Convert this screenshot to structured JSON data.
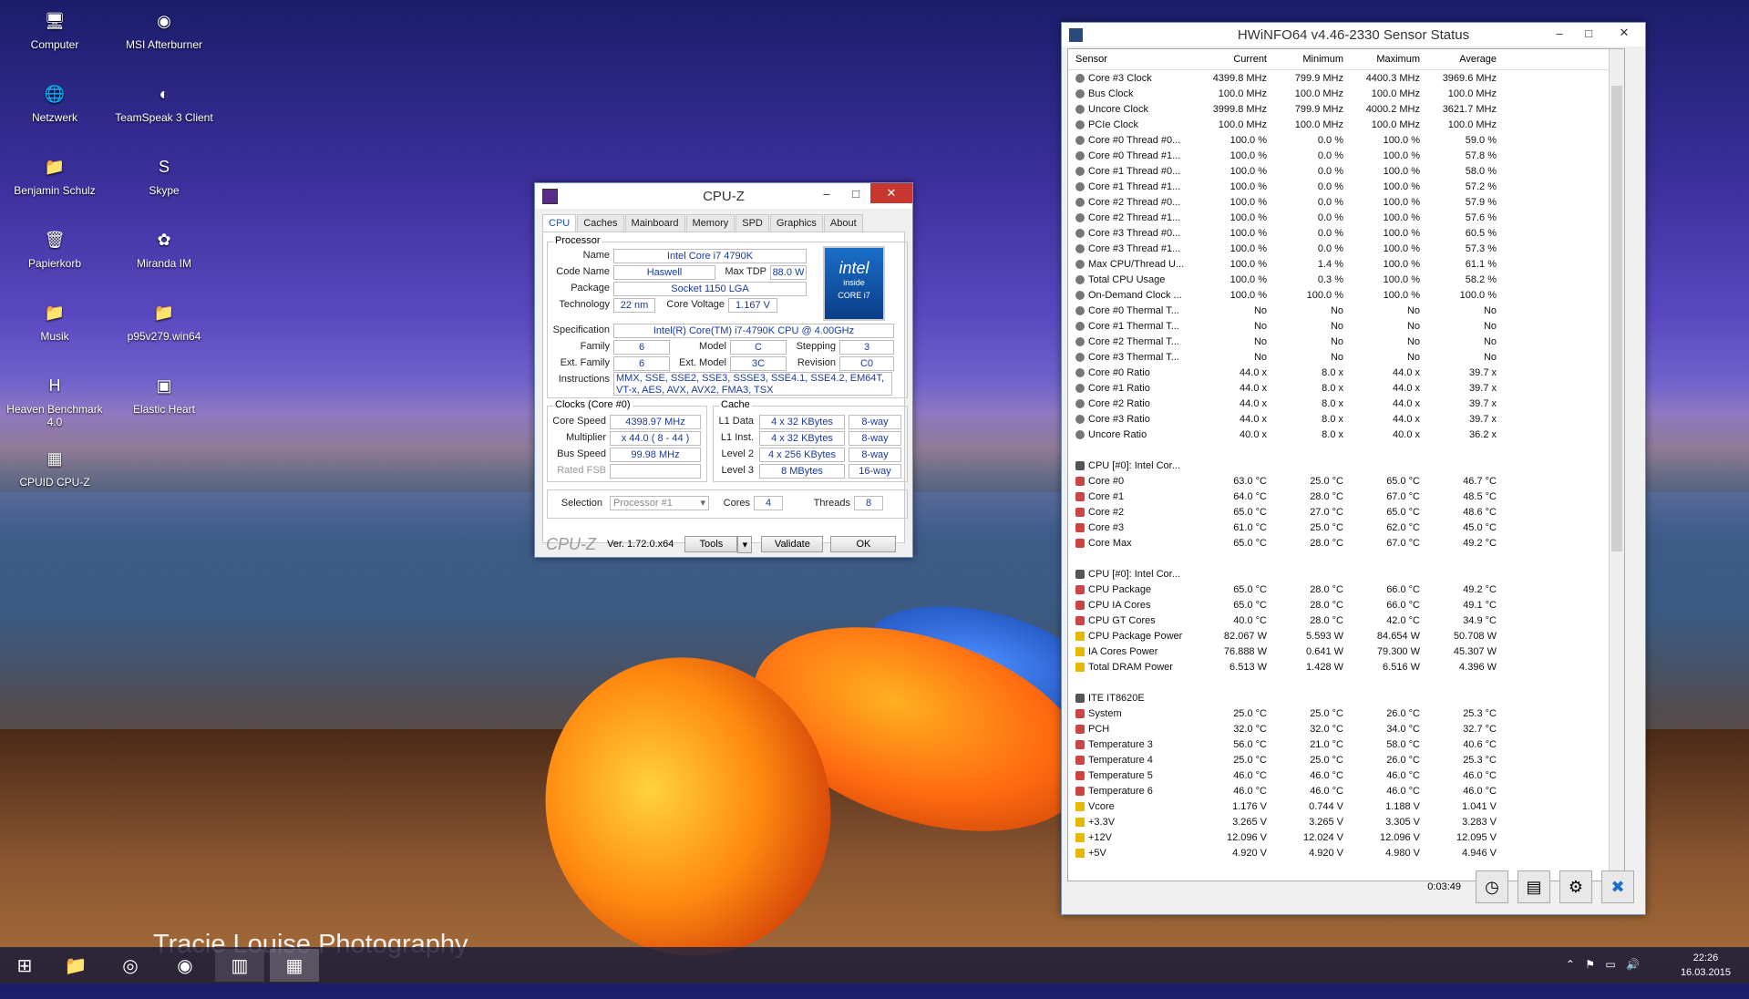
{
  "desktop": {
    "icons": [
      {
        "label": "Computer",
        "glyph": "🖥"
      },
      {
        "label": "MSI Afterburner",
        "glyph": "◉"
      },
      {
        "label": "Netzwerk",
        "glyph": "🌐"
      },
      {
        "label": "TeamSpeak 3 Client",
        "glyph": "◐"
      },
      {
        "label": "Benjamin Schulz",
        "glyph": "📁"
      },
      {
        "label": "Skype",
        "glyph": "S"
      },
      {
        "label": "Papierkorb",
        "glyph": "🗑"
      },
      {
        "label": "Miranda IM",
        "glyph": "✿"
      },
      {
        "label": "Musik",
        "glyph": "📁"
      },
      {
        "label": "p95v279.win64",
        "glyph": "📁"
      },
      {
        "label": "Heaven Benchmark 4.0",
        "glyph": "H"
      },
      {
        "label": "Elastic Heart",
        "glyph": "▣"
      },
      {
        "label": "CPUID CPU-Z",
        "glyph": "▦"
      }
    ],
    "photo_credit": "Tracie Louise Photography"
  },
  "cpuz": {
    "title": "CPU-Z",
    "tabs": [
      "CPU",
      "Caches",
      "Mainboard",
      "Memory",
      "SPD",
      "Graphics",
      "About"
    ],
    "processor_group": "Processor",
    "name_label": "Name",
    "name": "Intel Core i7 4790K",
    "codename_label": "Code Name",
    "codename": "Haswell",
    "maxtdp_label": "Max TDP",
    "maxtdp": "88.0 W",
    "package_label": "Package",
    "package": "Socket 1150 LGA",
    "technology_label": "Technology",
    "technology": "22 nm",
    "corevoltage_label": "Core Voltage",
    "corevoltage": "1.167 V",
    "spec_label": "Specification",
    "spec": "Intel(R) Core(TM) i7-4790K CPU @ 4.00GHz",
    "family_label": "Family",
    "family": "6",
    "model_label": "Model",
    "model": "C",
    "stepping_label": "Stepping",
    "stepping": "3",
    "extfamily_label": "Ext. Family",
    "extfamily": "6",
    "extmodel_label": "Ext. Model",
    "extmodel": "3C",
    "revision_label": "Revision",
    "revision": "C0",
    "instructions_label": "Instructions",
    "instructions": "MMX, SSE, SSE2, SSE3, SSSE3, SSE4.1, SSE4.2, EM64T, VT-x, AES, AVX, AVX2, FMA3, TSX",
    "intel_logo_top": "intel",
    "intel_logo_mid": "inside",
    "intel_logo_bot": "CORE i7",
    "clocks_group": "Clocks (Core #0)",
    "corespeed_label": "Core Speed",
    "corespeed": "4398.97 MHz",
    "multiplier_label": "Multiplier",
    "multiplier": "x 44.0 ( 8 - 44 )",
    "busspeed_label": "Bus Speed",
    "busspeed": "99.98 MHz",
    "ratedfsb_label": "Rated FSB",
    "ratedfsb": "",
    "cache_group": "Cache",
    "l1data_label": "L1 Data",
    "l1data": "4 x 32 KBytes",
    "l1data_way": "8-way",
    "l1inst_label": "L1 Inst.",
    "l1inst": "4 x 32 KBytes",
    "l1inst_way": "8-way",
    "level2_label": "Level 2",
    "level2": "4 x 256 KBytes",
    "level2_way": "8-way",
    "level3_label": "Level 3",
    "level3": "8 MBytes",
    "level3_way": "16-way",
    "selection_label": "Selection",
    "selection": "Processor #1",
    "cores_label": "Cores",
    "cores": "4",
    "threads_label": "Threads",
    "threads": "8",
    "brand": "CPU-Z",
    "version": "Ver. 1.72.0.x64",
    "tools_label": "Tools",
    "validate_label": "Validate",
    "ok_label": "OK"
  },
  "hwinfo": {
    "title": "HWiNFO64 v4.46-2330 Sensor Status",
    "columns": [
      "Sensor",
      "Current",
      "Minimum",
      "Maximum",
      "Average"
    ],
    "rows": [
      {
        "icon": "g",
        "name": "Core #3 Clock",
        "cur": "4399.8 MHz",
        "min": "799.9 MHz",
        "max": "4400.3 MHz",
        "avg": "3969.6 MHz"
      },
      {
        "icon": "g",
        "name": "Bus Clock",
        "cur": "100.0 MHz",
        "min": "100.0 MHz",
        "max": "100.0 MHz",
        "avg": "100.0 MHz"
      },
      {
        "icon": "g",
        "name": "Uncore Clock",
        "cur": "3999.8 MHz",
        "min": "799.9 MHz",
        "max": "4000.2 MHz",
        "avg": "3621.7 MHz"
      },
      {
        "icon": "g",
        "name": "PCIe Clock",
        "cur": "100.0 MHz",
        "min": "100.0 MHz",
        "max": "100.0 MHz",
        "avg": "100.0 MHz"
      },
      {
        "icon": "g",
        "name": "Core #0 Thread #0...",
        "cur": "100.0 %",
        "min": "0.0 %",
        "max": "100.0 %",
        "avg": "59.0 %"
      },
      {
        "icon": "g",
        "name": "Core #0 Thread #1...",
        "cur": "100.0 %",
        "min": "0.0 %",
        "max": "100.0 %",
        "avg": "57.8 %"
      },
      {
        "icon": "g",
        "name": "Core #1 Thread #0...",
        "cur": "100.0 %",
        "min": "0.0 %",
        "max": "100.0 %",
        "avg": "58.0 %"
      },
      {
        "icon": "g",
        "name": "Core #1 Thread #1...",
        "cur": "100.0 %",
        "min": "0.0 %",
        "max": "100.0 %",
        "avg": "57.2 %"
      },
      {
        "icon": "g",
        "name": "Core #2 Thread #0...",
        "cur": "100.0 %",
        "min": "0.0 %",
        "max": "100.0 %",
        "avg": "57.9 %"
      },
      {
        "icon": "g",
        "name": "Core #2 Thread #1...",
        "cur": "100.0 %",
        "min": "0.0 %",
        "max": "100.0 %",
        "avg": "57.6 %"
      },
      {
        "icon": "g",
        "name": "Core #3 Thread #0...",
        "cur": "100.0 %",
        "min": "0.0 %",
        "max": "100.0 %",
        "avg": "60.5 %"
      },
      {
        "icon": "g",
        "name": "Core #3 Thread #1...",
        "cur": "100.0 %",
        "min": "0.0 %",
        "max": "100.0 %",
        "avg": "57.3 %"
      },
      {
        "icon": "g",
        "name": "Max CPU/Thread U...",
        "cur": "100.0 %",
        "min": "1.4 %",
        "max": "100.0 %",
        "avg": "61.1 %"
      },
      {
        "icon": "g",
        "name": "Total CPU Usage",
        "cur": "100.0 %",
        "min": "0.3 %",
        "max": "100.0 %",
        "avg": "58.2 %"
      },
      {
        "icon": "g",
        "name": "On-Demand Clock ...",
        "cur": "100.0 %",
        "min": "100.0 %",
        "max": "100.0 %",
        "avg": "100.0 %"
      },
      {
        "icon": "g",
        "name": "Core #0 Thermal T...",
        "cur": "No",
        "min": "No",
        "max": "No",
        "avg": "No"
      },
      {
        "icon": "g",
        "name": "Core #1 Thermal T...",
        "cur": "No",
        "min": "No",
        "max": "No",
        "avg": "No"
      },
      {
        "icon": "g",
        "name": "Core #2 Thermal T...",
        "cur": "No",
        "min": "No",
        "max": "No",
        "avg": "No"
      },
      {
        "icon": "g",
        "name": "Core #3 Thermal T...",
        "cur": "No",
        "min": "No",
        "max": "No",
        "avg": "No"
      },
      {
        "icon": "g",
        "name": "Core #0 Ratio",
        "cur": "44.0 x",
        "min": "8.0 x",
        "max": "44.0 x",
        "avg": "39.7 x"
      },
      {
        "icon": "g",
        "name": "Core #1 Ratio",
        "cur": "44.0 x",
        "min": "8.0 x",
        "max": "44.0 x",
        "avg": "39.7 x"
      },
      {
        "icon": "g",
        "name": "Core #2 Ratio",
        "cur": "44.0 x",
        "min": "8.0 x",
        "max": "44.0 x",
        "avg": "39.7 x"
      },
      {
        "icon": "g",
        "name": "Core #3 Ratio",
        "cur": "44.0 x",
        "min": "8.0 x",
        "max": "44.0 x",
        "avg": "39.7 x"
      },
      {
        "icon": "g",
        "name": "Uncore Ratio",
        "cur": "40.0 x",
        "min": "8.0 x",
        "max": "40.0 x",
        "avg": "36.2 x"
      },
      {
        "icon": "",
        "name": "",
        "cur": "",
        "min": "",
        "max": "",
        "avg": ""
      },
      {
        "icon": "h",
        "name": "CPU [#0]: Intel Cor...",
        "cur": "",
        "min": "",
        "max": "",
        "avg": ""
      },
      {
        "icon": "t",
        "name": "Core #0",
        "cur": "63.0 °C",
        "min": "25.0 °C",
        "max": "65.0 °C",
        "avg": "46.7 °C"
      },
      {
        "icon": "t",
        "name": "Core #1",
        "cur": "64.0 °C",
        "min": "28.0 °C",
        "max": "67.0 °C",
        "avg": "48.5 °C"
      },
      {
        "icon": "t",
        "name": "Core #2",
        "cur": "65.0 °C",
        "min": "27.0 °C",
        "max": "65.0 °C",
        "avg": "48.6 °C"
      },
      {
        "icon": "t",
        "name": "Core #3",
        "cur": "61.0 °C",
        "min": "25.0 °C",
        "max": "62.0 °C",
        "avg": "45.0 °C"
      },
      {
        "icon": "t",
        "name": "Core Max",
        "cur": "65.0 °C",
        "min": "28.0 °C",
        "max": "67.0 °C",
        "avg": "49.2 °C"
      },
      {
        "icon": "",
        "name": "",
        "cur": "",
        "min": "",
        "max": "",
        "avg": ""
      },
      {
        "icon": "h",
        "name": "CPU [#0]: Intel Cor...",
        "cur": "",
        "min": "",
        "max": "",
        "avg": ""
      },
      {
        "icon": "t",
        "name": "CPU Package",
        "cur": "65.0 °C",
        "min": "28.0 °C",
        "max": "66.0 °C",
        "avg": "49.2 °C"
      },
      {
        "icon": "t",
        "name": "CPU IA Cores",
        "cur": "65.0 °C",
        "min": "28.0 °C",
        "max": "66.0 °C",
        "avg": "49.1 °C"
      },
      {
        "icon": "t",
        "name": "CPU GT Cores",
        "cur": "40.0 °C",
        "min": "28.0 °C",
        "max": "42.0 °C",
        "avg": "34.9 °C"
      },
      {
        "icon": "p",
        "name": "CPU Package Power",
        "cur": "82.067 W",
        "min": "5.593 W",
        "max": "84.654 W",
        "avg": "50.708 W"
      },
      {
        "icon": "p",
        "name": "IA Cores Power",
        "cur": "76.888 W",
        "min": "0.641 W",
        "max": "79.300 W",
        "avg": "45.307 W"
      },
      {
        "icon": "p",
        "name": "Total DRAM Power",
        "cur": "6.513 W",
        "min": "1.428 W",
        "max": "6.516 W",
        "avg": "4.396 W"
      },
      {
        "icon": "",
        "name": "",
        "cur": "",
        "min": "",
        "max": "",
        "avg": ""
      },
      {
        "icon": "h",
        "name": "ITE IT8620E",
        "cur": "",
        "min": "",
        "max": "",
        "avg": ""
      },
      {
        "icon": "t",
        "name": "System",
        "cur": "25.0 °C",
        "min": "25.0 °C",
        "max": "26.0 °C",
        "avg": "25.3 °C"
      },
      {
        "icon": "t",
        "name": "PCH",
        "cur": "32.0 °C",
        "min": "32.0 °C",
        "max": "34.0 °C",
        "avg": "32.7 °C"
      },
      {
        "icon": "t",
        "name": "Temperature 3",
        "cur": "56.0 °C",
        "min": "21.0 °C",
        "max": "58.0 °C",
        "avg": "40.6 °C"
      },
      {
        "icon": "t",
        "name": "Temperature 4",
        "cur": "25.0 °C",
        "min": "25.0 °C",
        "max": "26.0 °C",
        "avg": "25.3 °C"
      },
      {
        "icon": "t",
        "name": "Temperature 5",
        "cur": "46.0 °C",
        "min": "46.0 °C",
        "max": "46.0 °C",
        "avg": "46.0 °C"
      },
      {
        "icon": "t",
        "name": "Temperature 6",
        "cur": "46.0 °C",
        "min": "46.0 °C",
        "max": "46.0 °C",
        "avg": "46.0 °C"
      },
      {
        "icon": "p",
        "name": "Vcore",
        "cur": "1.176 V",
        "min": "0.744 V",
        "max": "1.188 V",
        "avg": "1.041 V"
      },
      {
        "icon": "p",
        "name": "+3.3V",
        "cur": "3.265 V",
        "min": "3.265 V",
        "max": "3.305 V",
        "avg": "3.283 V"
      },
      {
        "icon": "p",
        "name": "+12V",
        "cur": "12.096 V",
        "min": "12.024 V",
        "max": "12.096 V",
        "avg": "12.095 V"
      },
      {
        "icon": "p",
        "name": "+5V",
        "cur": "4.920 V",
        "min": "4.920 V",
        "max": "4.980 V",
        "avg": "4.946 V"
      }
    ],
    "elapsed": "0:03:49"
  },
  "taskbar": {
    "time": "22:26",
    "date": "16.03.2015"
  }
}
